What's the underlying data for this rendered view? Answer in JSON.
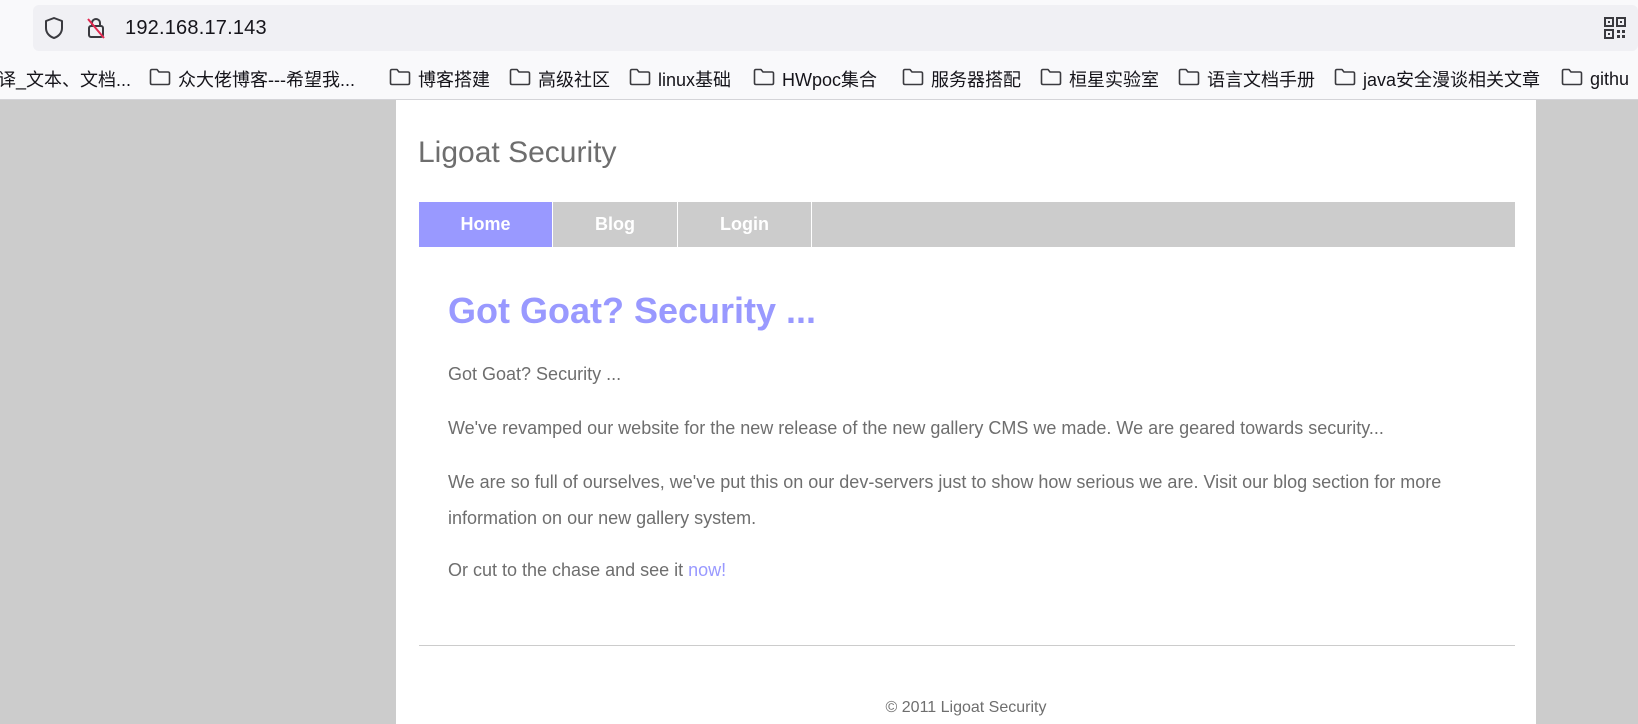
{
  "browser": {
    "url": "192.168.17.143",
    "icons": {
      "shield": "shield-icon",
      "lock": "insecure-lock-icon",
      "qr": "qr-code-icon",
      "folder": "folder-icon"
    },
    "bookmarks": [
      "译_文本、文档...",
      "众大佬博客---希望我...",
      "博客搭建",
      "高级社区",
      "linux基础",
      "HWpoc集合",
      "服务器搭配",
      "桓星实验室",
      "语言文档手册",
      "java安全漫谈相关文章",
      "githu"
    ]
  },
  "site": {
    "title": "Ligoat Security",
    "nav": {
      "home": "Home",
      "blog": "Blog",
      "login": "Login"
    },
    "heading": "Got Goat? Security ...",
    "paragraphs": {
      "p1": "Got Goat? Security ...",
      "p2": "We've revamped our website for the new release of the new gallery CMS we made. We are geared towards security...",
      "p3": "We are so full of ourselves, we've put this on our dev-servers just to show how serious we are. Visit our blog section for more information on our new gallery system.",
      "p4_prefix": "Or cut to the chase and see it ",
      "p4_link": "now!"
    },
    "footer": "© 2011 Ligoat Security"
  },
  "colors": {
    "accent": "#9999ff",
    "text": "#6e6e6e",
    "nav_bg": "#cccccc",
    "page_bg": "#cccccc"
  }
}
